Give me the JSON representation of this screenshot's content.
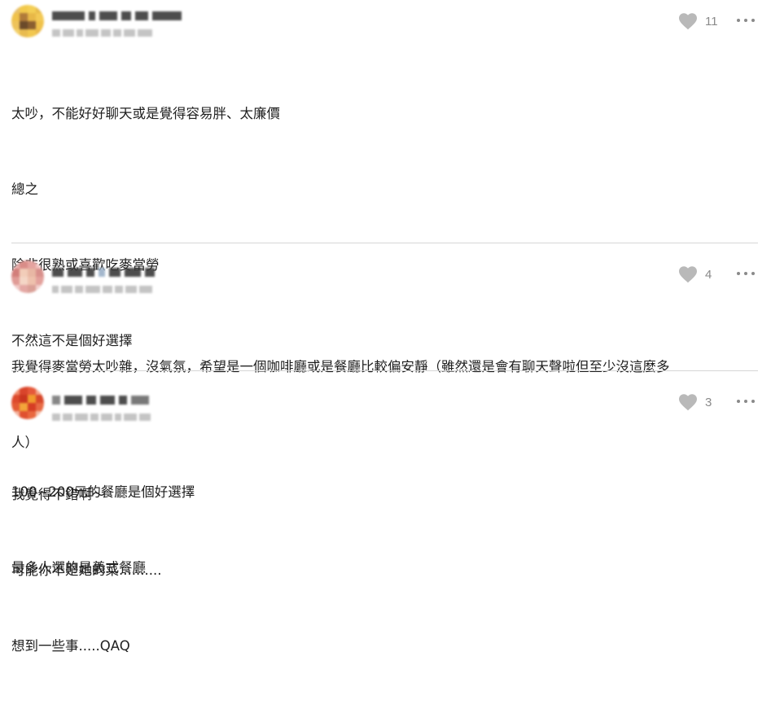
{
  "comments": [
    {
      "likes": "11",
      "lines": [
        "太吵，不能好好聊天或是覺得容易胖、太廉價",
        "總之",
        "除非很熟或喜歡吃麥當勞",
        "不然這不是個好選擇",
        "",
        "100~200元的餐廳是個好選擇",
        "最多人選的是義式餐廳"
      ]
    },
    {
      "likes": "4",
      "lines": [
        "我覺得麥當勞太吵雜，沒氣氛，希望是一個咖啡廳或是餐廳比較偏安靜（雖然還是會有聊天聲啦但至少沒這麼多",
        "人）"
      ]
    },
    {
      "likes": "3",
      "lines": [
        "我覺得不錯啊～",
        "可能你不是她的菜..........",
        "想到一些事.....QAQ"
      ]
    }
  ],
  "icons": {
    "like": "heart-icon",
    "more": "more-dots-icon"
  },
  "colors": {
    "heart": "#b9b9b9",
    "count": "#8a8a8a",
    "divider": "#d6d6d6",
    "text": "#1f1f1f"
  }
}
